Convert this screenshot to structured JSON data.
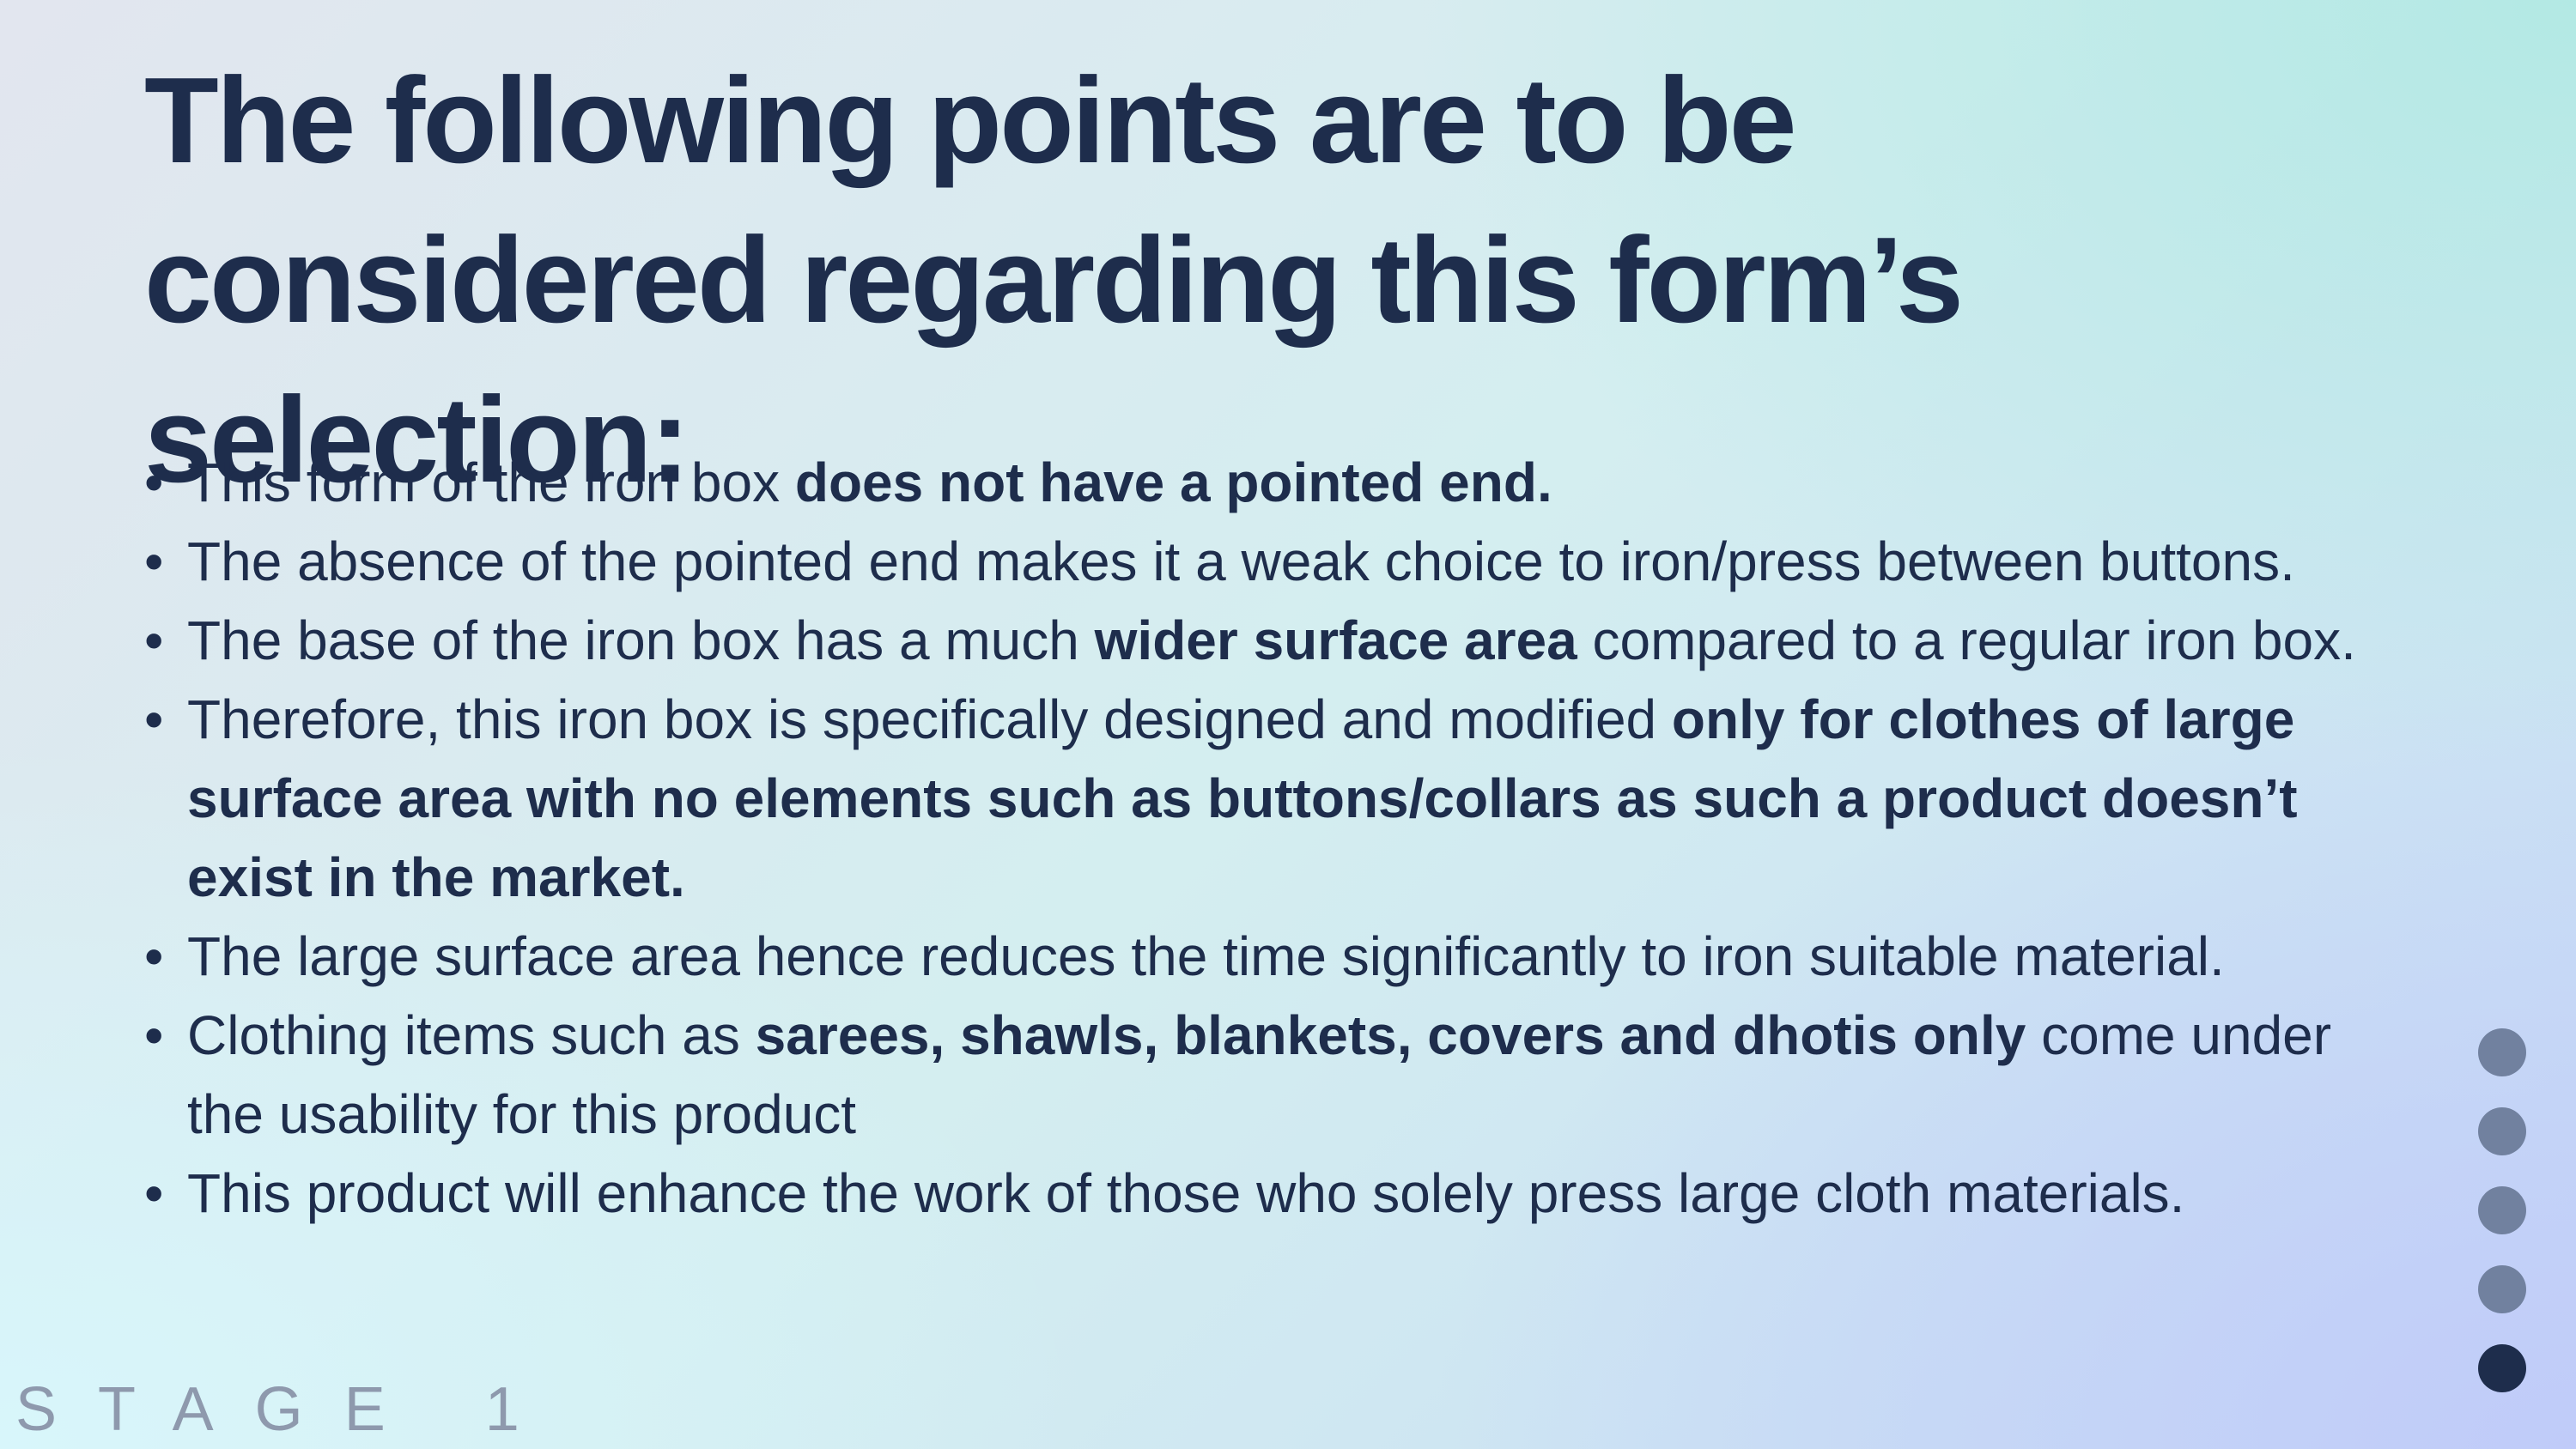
{
  "slide": {
    "title": "The following points are to be considered regarding this form’s selection:",
    "bullets": [
      {
        "parts": [
          {
            "text": "This form of the iron box ",
            "bold": false
          },
          {
            "text": "does not have a pointed end.",
            "bold": true
          }
        ]
      },
      {
        "parts": [
          {
            "text": "The absence of the pointed end makes it a weak choice to iron/press between buttons.",
            "bold": false
          }
        ]
      },
      {
        "parts": [
          {
            "text": "The base of the iron box has a much ",
            "bold": false
          },
          {
            "text": "wider surface area",
            "bold": true
          },
          {
            "text": " compared to a regular iron box.",
            "bold": false
          }
        ]
      },
      {
        "parts": [
          {
            "text": "Therefore, this iron box is specifically designed and modified ",
            "bold": false
          },
          {
            "text": "only for clothes of large surface area with no elements such as buttons/collars as such a product doesn’t exist in the market.",
            "bold": true
          }
        ]
      },
      {
        "parts": [
          {
            "text": "The large surface area hence reduces the time significantly to iron suitable material.",
            "bold": false
          }
        ]
      },
      {
        "parts": [
          {
            "text": "Clothing items such as ",
            "bold": false
          },
          {
            "text": "sarees, shawls, blankets, covers and dhotis only",
            "bold": true
          },
          {
            "text": " come under the usability for this product",
            "bold": false
          }
        ]
      },
      {
        "parts": [
          {
            "text": "This product will enhance the work of those who solely press large cloth materials.",
            "bold": false
          }
        ]
      }
    ],
    "stage_label": "STAGE 1"
  },
  "navigation": {
    "dots": [
      {
        "active": false
      },
      {
        "active": false
      },
      {
        "active": false
      },
      {
        "active": false
      },
      {
        "active": true
      }
    ],
    "colors": {
      "inactive": "#71819f",
      "active": "#1e2d4c"
    }
  }
}
